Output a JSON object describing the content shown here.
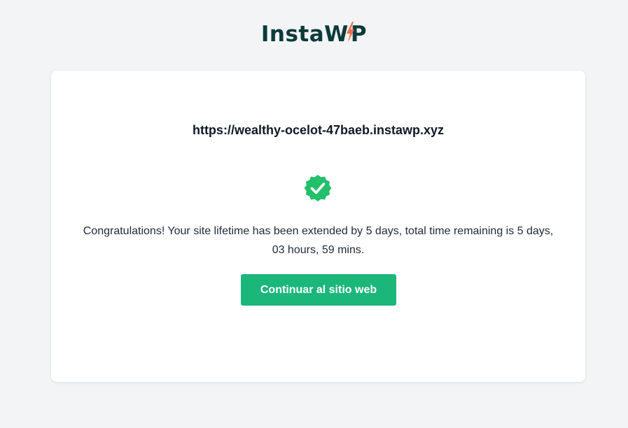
{
  "brand": {
    "logo_part1": "Insta",
    "logo_part2": "P",
    "logo_text_color": "#0b3b3b",
    "bolt_color": "#f26b50",
    "logo_icon": "lightning-bolt-icon"
  },
  "card": {
    "site_url": "https://wealthy-ocelot-47baeb.instawp.xyz",
    "status_icon": "check-badge-icon",
    "status_color": "#22c06a",
    "message": "Congratulations! Your site lifetime has been extended by 5 days, total time remaining is 5 days, 03 hours, 59 mins.",
    "button_label": "Continuar al sitio web",
    "button_color": "#1bb67a"
  }
}
